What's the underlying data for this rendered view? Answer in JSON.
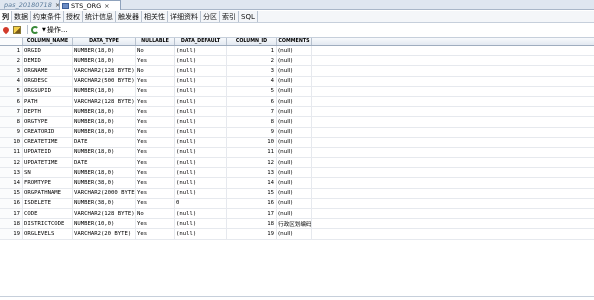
{
  "doc_tabs": [
    {
      "label": "pas_20180718",
      "active": false
    },
    {
      "label": "STS_ORG",
      "active": true
    }
  ],
  "close_glyph": "×",
  "sub_tabs": [
    "列",
    "数据",
    "约束条件",
    "授权",
    "统计信息",
    "触发器",
    "相关性",
    "详细资料",
    "分区",
    "索引",
    "SQL"
  ],
  "active_sub_tab": 0,
  "toolbar": {
    "actions_label": "操作..."
  },
  "columns": [
    "",
    "COLUMN_NAME",
    "DATA_TYPE",
    "NULLABLE",
    "DATA_DEFAULT",
    "COLUMN_ID",
    "COMMENTS"
  ],
  "rows": [
    [
      "1",
      "ORGID",
      "NUMBER(18,0)",
      "No",
      "(null)",
      "1",
      "(null)"
    ],
    [
      "2",
      "DEMID",
      "NUMBER(18,0)",
      "Yes",
      "(null)",
      "2",
      "(null)"
    ],
    [
      "3",
      "ORGNAME",
      "VARCHAR2(128 BYTE)",
      "No",
      "(null)",
      "3",
      "(null)"
    ],
    [
      "4",
      "ORGDESC",
      "VARCHAR2(500 BYTE)",
      "Yes",
      "(null)",
      "4",
      "(null)"
    ],
    [
      "5",
      "ORGSUPID",
      "NUMBER(18,0)",
      "Yes",
      "(null)",
      "5",
      "(null)"
    ],
    [
      "6",
      "PATH",
      "VARCHAR2(128 BYTE)",
      "Yes",
      "(null)",
      "6",
      "(null)"
    ],
    [
      "7",
      "DEPTH",
      "NUMBER(18,0)",
      "Yes",
      "(null)",
      "7",
      "(null)"
    ],
    [
      "8",
      "ORGTYPE",
      "NUMBER(18,0)",
      "Yes",
      "(null)",
      "8",
      "(null)"
    ],
    [
      "9",
      "CREATORID",
      "NUMBER(18,0)",
      "Yes",
      "(null)",
      "9",
      "(null)"
    ],
    [
      "10",
      "CREATETIME",
      "DATE",
      "Yes",
      "(null)",
      "10",
      "(null)"
    ],
    [
      "11",
      "UPDATEID",
      "NUMBER(18,0)",
      "Yes",
      "(null)",
      "11",
      "(null)"
    ],
    [
      "12",
      "UPDATETIME",
      "DATE",
      "Yes",
      "(null)",
      "12",
      "(null)"
    ],
    [
      "13",
      "SN",
      "NUMBER(18,0)",
      "Yes",
      "(null)",
      "13",
      "(null)"
    ],
    [
      "14",
      "FROMTYPE",
      "NUMBER(38,0)",
      "Yes",
      "(null)",
      "14",
      "(null)"
    ],
    [
      "15",
      "ORGPATHNAME",
      "VARCHAR2(2000 BYTE)",
      "Yes",
      "(null)",
      "15",
      "(null)"
    ],
    [
      "16",
      "ISDELETE",
      "NUMBER(38,0)",
      "Yes",
      "0",
      "16",
      "(null)"
    ],
    [
      "17",
      "CODE",
      "VARCHAR2(128 BYTE)",
      "No",
      "(null)",
      "17",
      "(null)"
    ],
    [
      "18",
      "DISTRICTCODE",
      "NUMBER(10,0)",
      "Yes",
      "(null)",
      "18",
      "行政区划编码"
    ],
    [
      "19",
      "ORGLEVELS",
      "VARCHAR2(20 BYTE)",
      "Yes",
      "(null)",
      "19",
      "(null)"
    ]
  ],
  "icons": {
    "pin": "pin-icon",
    "edit": "edit-icon",
    "refresh": "refresh-icon",
    "dropdown": "chevron-down-icon"
  }
}
